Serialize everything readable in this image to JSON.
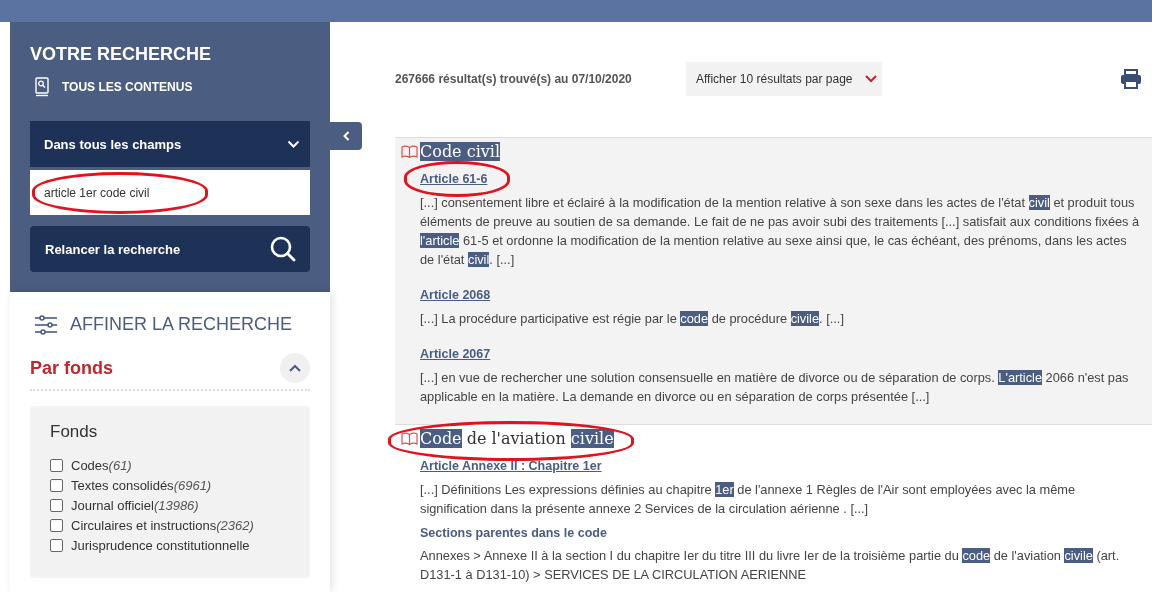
{
  "search_panel": {
    "title": "VOTRE RECHERCHE",
    "scope": "TOUS LES CONTENUS",
    "field_dropdown": {
      "label": "Dans tous les champs"
    },
    "query": {
      "value": "article 1er code civil",
      "circled": true
    },
    "rerun_button": "Relancer la recherche"
  },
  "refine_panel": {
    "title": "AFFINER LA RECHERCHE",
    "section": {
      "label": "Par fonds",
      "expanded": true
    },
    "filter_group": {
      "title": "Fonds",
      "options": [
        {
          "label": "Codes",
          "count": "(61)",
          "checked": false
        },
        {
          "label": "Textes consolidés",
          "count": "(6961)",
          "checked": false
        },
        {
          "label": "Journal officiel",
          "count": "(13986)",
          "checked": false
        },
        {
          "label": "Circulaires et instructions",
          "count": "(2362)",
          "checked": false
        },
        {
          "label": "Jurisprudence constitutionnelle",
          "checked": false
        }
      ]
    }
  },
  "results_header": {
    "count_text": "267666 résultat(s) trouvé(s) au 07/10/2020",
    "page_size_select": "Afficher 10 résultats par page"
  },
  "results": [
    {
      "title": [
        {
          "text": "Code civil",
          "highlighted": true
        }
      ],
      "circled": false,
      "shaded": true,
      "articles": [
        {
          "link": "Article 61-6",
          "circled": true,
          "snippet": [
            {
              "text": "[...] consentement libre et éclairé à la modification de la mention relative à son sexe dans les actes de l'état ",
              "highlighted": false
            },
            {
              "text": "civil",
              "highlighted": true
            },
            {
              "text": " et produit tous éléments de preuve au soutien de sa demande. Le fait de ne pas avoir subi des traitements [...] satisfait aux conditions fixées à ",
              "highlighted": false
            },
            {
              "text": "l'article",
              "highlighted": true
            },
            {
              "text": " 61-5 et ordonne la modification de la mention relative au sexe ainsi que, le cas échéant, des prénoms, dans les actes de l'état ",
              "highlighted": false
            },
            {
              "text": "civil",
              "highlighted": true
            },
            {
              "text": ". [...]",
              "highlighted": false
            }
          ]
        },
        {
          "link": "Article 2068",
          "circled": false,
          "snippet": [
            {
              "text": "[...] La procédure participative est régie par le ",
              "highlighted": false
            },
            {
              "text": "code",
              "highlighted": true
            },
            {
              "text": " de procédure ",
              "highlighted": false
            },
            {
              "text": "civile",
              "highlighted": true
            },
            {
              "text": ". [...]",
              "highlighted": false
            }
          ]
        },
        {
          "link": "Article 2067",
          "circled": false,
          "snippet": [
            {
              "text": "[...] en vue de rechercher une solution consensuelle en matière de divorce ou de séparation de corps. ",
              "highlighted": false
            },
            {
              "text": "L'article",
              "highlighted": true
            },
            {
              "text": " 2066 n'est pas applicable en la matière. La demande en divorce ou en séparation de corps présentée [...]",
              "highlighted": false
            }
          ]
        }
      ]
    },
    {
      "title": [
        {
          "text": "Code",
          "highlighted": true
        },
        {
          "text": " de l'aviation ",
          "highlighted": false
        },
        {
          "text": "civile",
          "highlighted": true
        }
      ],
      "circled": true,
      "shaded": false,
      "articles": [
        {
          "link": "Article Annexe II : Chapitre 1er",
          "circled": false,
          "snippet": [
            {
              "text": "[...] Définitions Les expressions définies au chapitre ",
              "highlighted": false
            },
            {
              "text": "1er",
              "highlighted": true
            },
            {
              "text": " de l'annexe 1 Règles de l'Air sont employées avec la même signification dans la présente annexe 2 Services de la circulation aérienne . [...]",
              "highlighted": false
            }
          ]
        }
      ],
      "sections": {
        "heading": "Sections parentes dans le code",
        "path": [
          {
            "text": "Annexes > Annexe II à la section I du chapitre Ier du titre III du livre Ier de la troisième partie du ",
            "highlighted": false
          },
          {
            "text": "code",
            "highlighted": true
          },
          {
            "text": " de l'aviation ",
            "highlighted": false
          },
          {
            "text": "civile",
            "highlighted": true
          },
          {
            "text": " (art. D131-1 à D131-10) > SERVICES DE LA CIRCULATION AERIENNE",
            "highlighted": false
          }
        ]
      }
    }
  ]
}
